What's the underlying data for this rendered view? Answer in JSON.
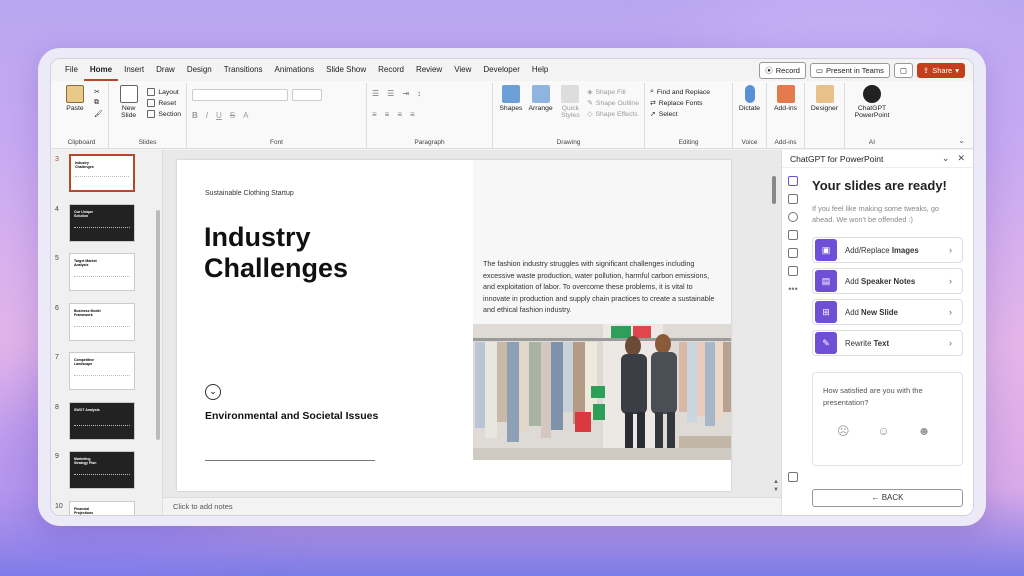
{
  "menu": {
    "tabs": [
      "File",
      "Home",
      "Insert",
      "Draw",
      "Design",
      "Transitions",
      "Animations",
      "Slide Show",
      "Record",
      "Review",
      "View",
      "Developer",
      "Help"
    ],
    "record_btn": "Record",
    "present_btn": "Present in Teams",
    "share_btn": "Share"
  },
  "ribbon": {
    "paste": "Paste",
    "clipboard": "Clipboard",
    "new_slide": "New Slide",
    "layout": "Layout",
    "reset": "Reset",
    "section": "Section",
    "slides": "Slides",
    "font": "Font",
    "paragraph": "Paragraph",
    "shapes": "Shapes",
    "arrange": "Arrange",
    "quick_styles": "Quick Styles",
    "shape_fill": "Shape Fill",
    "shape_outline": "Shape Outline",
    "shape_effects": "Shape Effects",
    "drawing": "Drawing",
    "find_replace": "Find and Replace",
    "replace_fonts": "Replace Fonts",
    "select": "Select",
    "editing": "Editing",
    "dictate": "Dictate",
    "voice": "Voice",
    "addins": "Add-ins",
    "addins_group": "Add-ins",
    "designer": "Designer",
    "chatgpt": "ChatGPT PowerPoint",
    "ai": "AI"
  },
  "thumbnails": [
    {
      "num": "3",
      "title": "Industry Challenges",
      "dark": false,
      "selected": true
    },
    {
      "num": "4",
      "title": "Our Unique Solution",
      "dark": true,
      "selected": false
    },
    {
      "num": "5",
      "title": "Target Market Analysis",
      "dark": false,
      "selected": false
    },
    {
      "num": "6",
      "title": "Business Model Framework",
      "dark": false,
      "selected": false
    },
    {
      "num": "7",
      "title": "Competitive Landscape",
      "dark": false,
      "selected": false
    },
    {
      "num": "8",
      "title": "SWOT Analysis",
      "dark": true,
      "selected": false
    },
    {
      "num": "9",
      "title": "Marketing Strategy Plan",
      "dark": true,
      "selected": false
    },
    {
      "num": "10",
      "title": "Financial Projections Overview",
      "dark": false,
      "selected": false
    }
  ],
  "slide": {
    "subtitle": "Sustainable Clothing Startup",
    "title_line1": "Industry",
    "title_line2": "Challenges",
    "body": "The fashion industry struggles with significant challenges including excessive waste production, water pollution, harmful carbon emissions, and exploitation of labor. To overcome these problems, it is vital to innovate in production and supply chain practices to create a sustainable and ethical fashion industry.",
    "section_title": "Environmental and Societal Issues"
  },
  "notes_placeholder": "Click to add notes",
  "panel": {
    "header": "ChatGPT for PowerPoint",
    "ready": "Your slides are ready!",
    "hint": "If you feel like making some tweaks, go ahead. We won't be offended :)",
    "actions": [
      {
        "prefix": "Add/Replace ",
        "bold": "Images"
      },
      {
        "prefix": "Add ",
        "bold": "Speaker Notes"
      },
      {
        "prefix": "Add ",
        "bold": "New Slide"
      },
      {
        "prefix": "Rewrite ",
        "bold": "Text"
      }
    ],
    "survey_q": "How satisfied are you with the presentation?",
    "back": "BACK"
  },
  "colors": {
    "accent": "#b7472a",
    "share": "#c43e1c",
    "panel_icon": "#6e4fd6"
  }
}
